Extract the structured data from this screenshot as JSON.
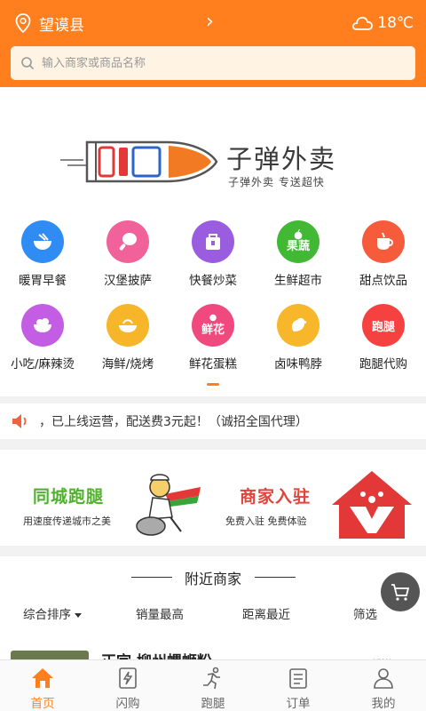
{
  "header": {
    "location": "望谟县",
    "temperature": "18℃",
    "search_placeholder": "输入商家或商品名称"
  },
  "banner": {
    "title": "子弹外卖",
    "subtitle": "子弹外卖  专送超快"
  },
  "categories": [
    {
      "label": "暖胃早餐",
      "icon": "bowl-icon",
      "color": "#2f8cf5"
    },
    {
      "label": "汉堡披萨",
      "icon": "drumstick-icon",
      "color": "#f2629a"
    },
    {
      "label": "快餐炒菜",
      "icon": "takeout-box-icon",
      "color": "#9a5de0"
    },
    {
      "label": "生鲜超市",
      "icon": "apple-icon",
      "badge": "果蔬",
      "color": "#41b935"
    },
    {
      "label": "甜点饮品",
      "icon": "cup-icon",
      "color": "#f65b3c"
    },
    {
      "label": "小吃/麻辣烫",
      "icon": "salad-bowl-icon",
      "color": "#c35de3"
    },
    {
      "label": "海鲜/烧烤",
      "icon": "seafood-plate-icon",
      "color": "#f7b529"
    },
    {
      "label": "鲜花蛋糕",
      "icon": "flower-icon",
      "badge": "鲜花",
      "color": "#f0497d"
    },
    {
      "label": "卤味鸭脖",
      "icon": "duck-icon",
      "color": "#f8b62b"
    },
    {
      "label": "跑腿代购",
      "icon": "errand-icon",
      "badge": "跑腿",
      "color": "#f64141"
    }
  ],
  "notice": {
    "text": "，已上线运营，配送费3元起！（诚招全国代理）"
  },
  "promo": {
    "left_title": "同城跑腿",
    "left_subtitle": "用速度传递城市之美",
    "right_title": "商家入驻",
    "right_subtitle": "免费入驻   免费体验"
  },
  "nearby": {
    "title": "附近商家",
    "sort_options": [
      "综合排序",
      "销量最高",
      "距离最近",
      "筛选"
    ],
    "first_shop_name": "正宗 柳州螺蛳粉",
    "first_shop_tag": "起送"
  },
  "tabbar": {
    "items": [
      {
        "label": "首页",
        "icon": "home-icon",
        "active": true
      },
      {
        "label": "闪购",
        "icon": "flash-buy-icon",
        "active": false
      },
      {
        "label": "跑腿",
        "icon": "runner-icon",
        "active": false
      },
      {
        "label": "订单",
        "icon": "order-list-icon",
        "active": false
      },
      {
        "label": "我的",
        "icon": "user-icon",
        "active": false
      }
    ]
  },
  "colors": {
    "brand_orange": "#ff7f1f",
    "green": "#4fb12e",
    "red": "#e2433a"
  }
}
